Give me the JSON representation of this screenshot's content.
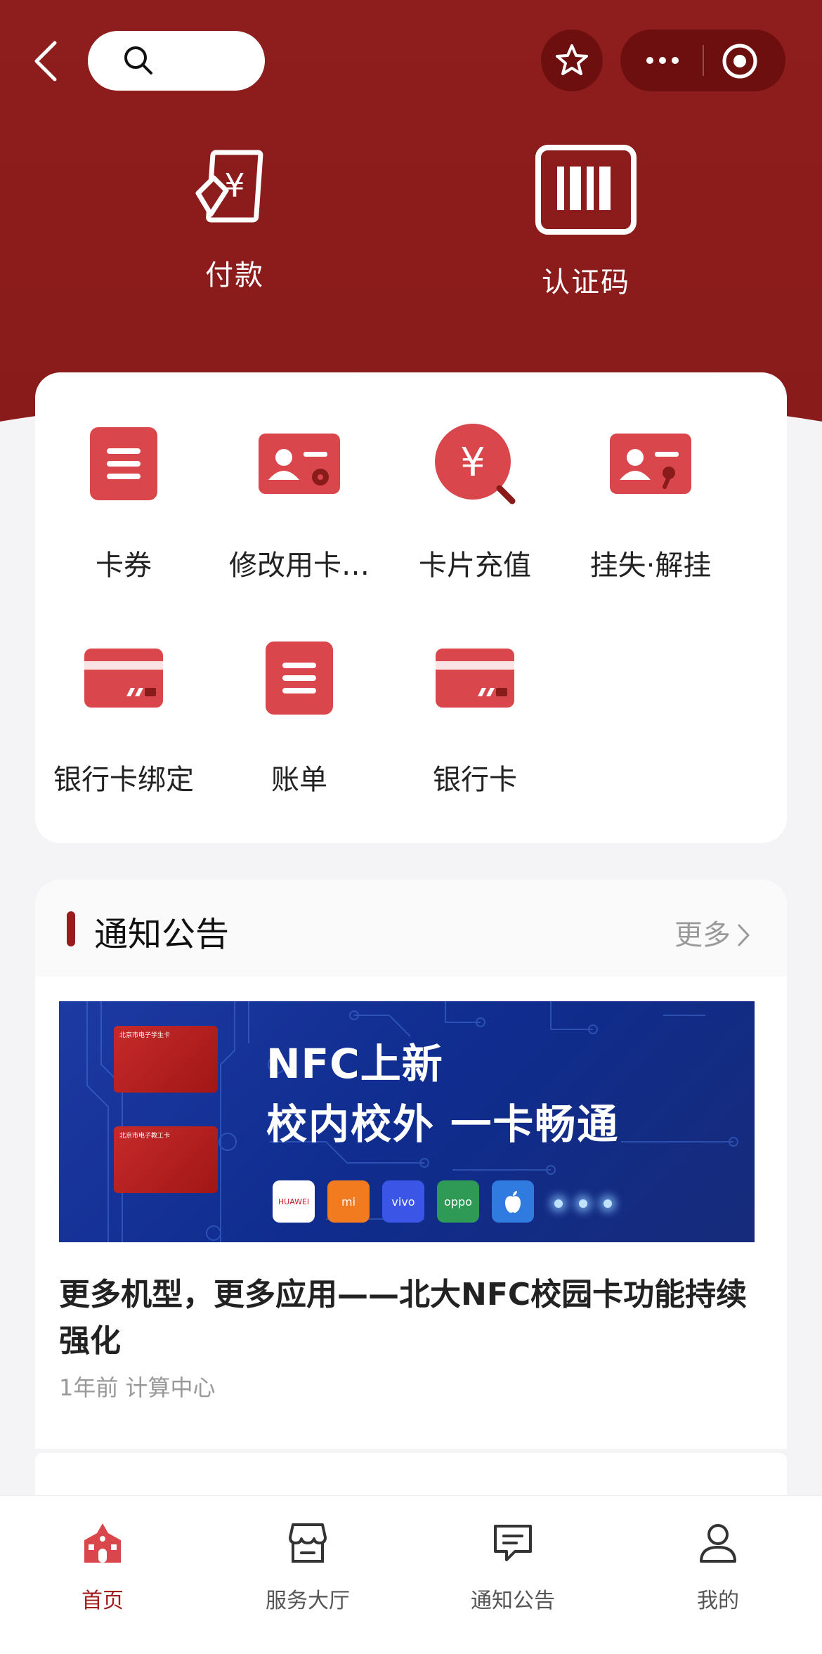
{
  "header": {
    "hero_actions": [
      {
        "label": "付款",
        "icon": "payment-icon"
      },
      {
        "label": "认证码",
        "icon": "barcode-icon"
      }
    ]
  },
  "services": {
    "items": [
      {
        "label": "卡券",
        "icon": "list-icon"
      },
      {
        "label": "修改用卡…",
        "icon": "card-settings-icon"
      },
      {
        "label": "卡片充值",
        "icon": "recharge-icon"
      },
      {
        "label": "挂失·解挂",
        "icon": "card-lock-icon"
      },
      {
        "label": "银行卡绑定",
        "icon": "bank-card-icon"
      },
      {
        "label": "账单",
        "icon": "bill-icon"
      },
      {
        "label": "银行卡",
        "icon": "bank-card-icon"
      }
    ]
  },
  "notice": {
    "title": "通知公告",
    "more": "更多",
    "banner": {
      "line1": "NFC上新",
      "line2": "校内校外 一卡畅通",
      "card_text": "北京市电子学生卡",
      "card_text2": "北京市电子教工卡",
      "brands": [
        "HUAWEI",
        "mi",
        "vivo",
        "oppo",
        "apple"
      ]
    },
    "article": {
      "title": "更多机型，更多应用——北大NFC校园卡功能持续强化",
      "meta": "1年前 计算中心"
    }
  },
  "tabbar": {
    "items": [
      {
        "label": "首页",
        "active": true
      },
      {
        "label": "服务大厅",
        "active": false
      },
      {
        "label": "通知公告",
        "active": false
      },
      {
        "label": "我的",
        "active": false
      }
    ]
  },
  "colors": {
    "primary": "#8e1d1d",
    "accent": "#d9474d",
    "active_tab": "#a01d1d"
  }
}
